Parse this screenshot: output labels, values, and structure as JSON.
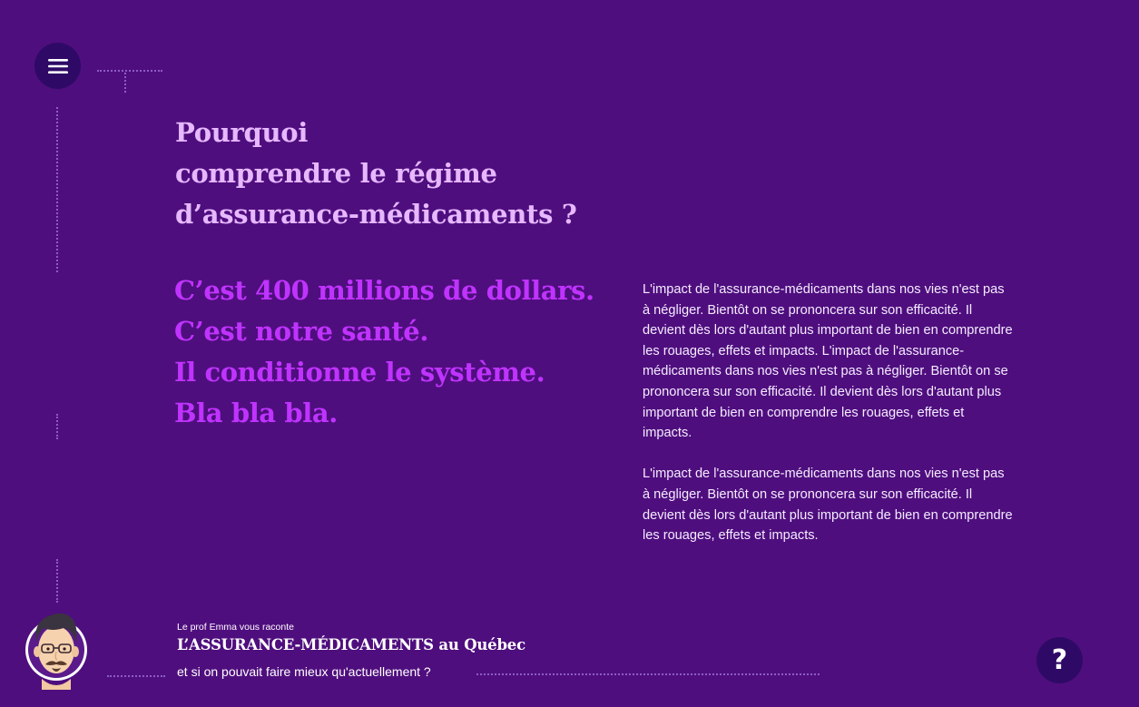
{
  "menu": {
    "icon": "hamburger-menu-icon"
  },
  "heading": {
    "lines": [
      "Pourquoi",
      "comprendre le régime",
      "d’assurance-médicaments ?"
    ]
  },
  "statements": [
    "C’est 400 millions de dollars.",
    "C’est notre santé.",
    "Il conditionne le système.",
    "Bla bla bla."
  ],
  "body": {
    "paragraphs": [
      "L'impact de l'assurance-médicaments dans nos vies n'est pas à négliger. Bientôt on se prononcera sur son efficacité. Il devient dès lors d'autant plus important de bien en comprendre les rouages, effets et impacts. L'impact de l'assurance-médicaments dans nos vies n'est pas à négliger. Bientôt on se prononcera sur son efficacité. Il devient dès lors d'autant plus important de bien en comprendre les rouages, effets et impacts.",
      "L'impact de l'assurance-médicaments dans nos vies n'est pas à négliger. Bientôt on se prononcera sur son efficacité. Il devient dès lors d'autant plus important de bien en comprendre les rouages, effets et impacts."
    ]
  },
  "footer": {
    "kicker": "Le prof Emma vous raconte",
    "title": "L’ASSURANCE-MÉDICAMENTS au Québec",
    "subtitle": "et si on pouvait faire mieux qu'actuellement ?",
    "avatar_icon": "professor-avatar"
  },
  "help": {
    "label": "?",
    "icon": "help-icon"
  },
  "colors": {
    "background": "#4f0e7e",
    "heading": "#e6b8ff",
    "accent": "#c033ff",
    "button": "#2e0a66"
  }
}
